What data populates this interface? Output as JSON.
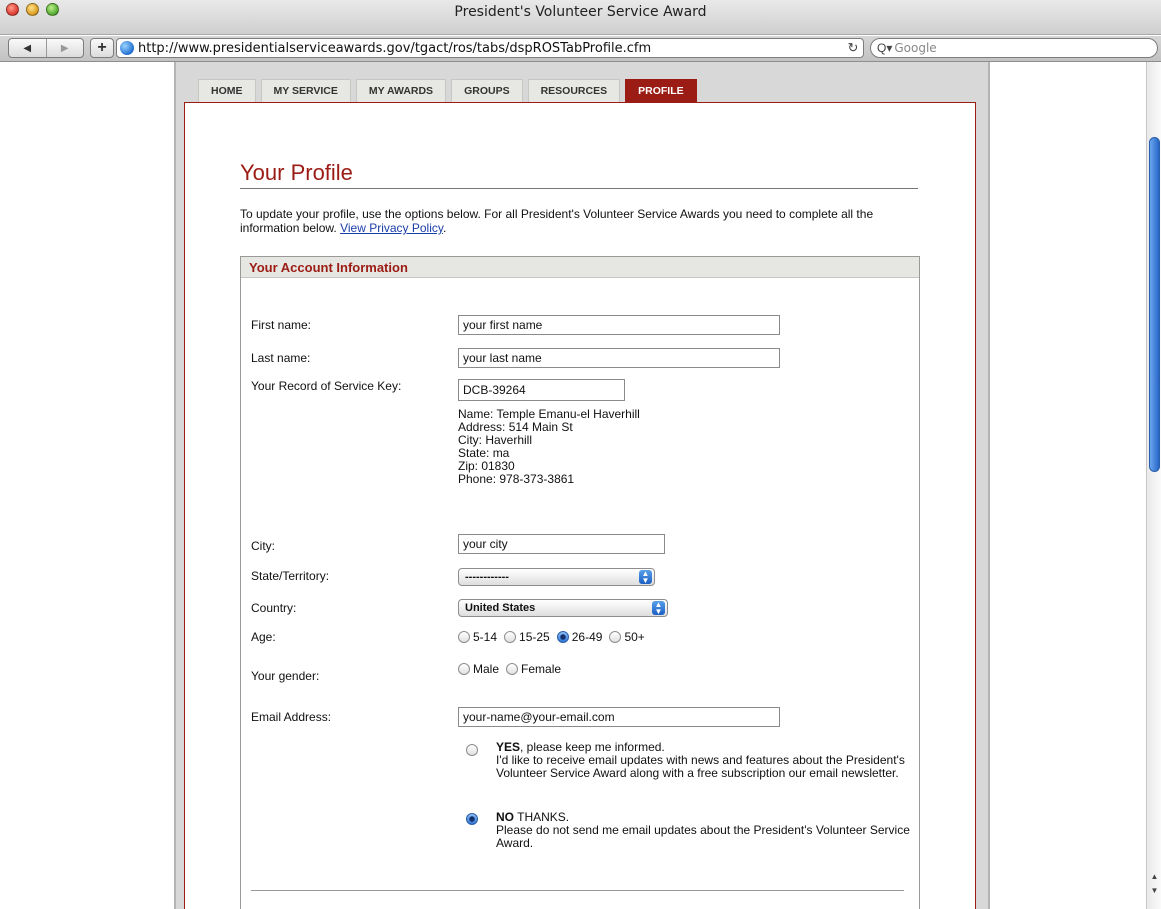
{
  "window": {
    "title": "President's Volunteer Service Award"
  },
  "browser": {
    "url": "http://www.presidentialserviceawards.gov/tgact/ros/tabs/dspROSTabProfile.cfm",
    "search_placeholder": "Google",
    "back_icon": "◀",
    "forward_icon": "▶",
    "add_icon": "+",
    "reload_icon": "↻",
    "search_icon": "Q▾"
  },
  "tabs": [
    {
      "label": "HOME",
      "active": false
    },
    {
      "label": "MY SERVICE",
      "active": false
    },
    {
      "label": "MY AWARDS",
      "active": false
    },
    {
      "label": "GROUPS",
      "active": false
    },
    {
      "label": "RESOURCES",
      "active": false
    },
    {
      "label": "PROFILE",
      "active": true
    }
  ],
  "page": {
    "title": "Your Profile",
    "intro": "To update your profile, use the options below. For all President's Volunteer Service Awards you need to complete all the information below.",
    "privacy_link": "View Privacy Policy",
    "privacy_suffix": "."
  },
  "account": {
    "header": "Your Account Information",
    "first_name": {
      "label": "First name:",
      "value": "your first name"
    },
    "last_name": {
      "label": "Last name:",
      "value": "your last name"
    },
    "record_key": {
      "label": "Your Record of Service Key:",
      "value": "DCB-39264",
      "info": [
        "Name: Temple Emanu-el Haverhill",
        "Address: 514 Main St",
        "City: Haverhill",
        "State: ma",
        "Zip: 01830",
        "Phone: 978-373-3861"
      ]
    },
    "city": {
      "label": "City:",
      "value": "your city"
    },
    "state": {
      "label": "State/Territory:",
      "value": "------------"
    },
    "country": {
      "label": "Country:",
      "value": "United States"
    },
    "age": {
      "label": "Age:",
      "options": [
        "5-14",
        "15-25",
        "26-49",
        "50+"
      ],
      "selected": "26-49"
    },
    "gender": {
      "label": "Your gender:",
      "options": [
        "Male",
        "Female"
      ],
      "selected": null
    },
    "email": {
      "label": "Email Address:",
      "value": "your-name@your-email.com"
    },
    "updates_yes": {
      "bold": "YES",
      "rest": ", please keep me informed.",
      "detail": "I'd like to receive email updates with news and features about the President's Volunteer Service Award along with a free subscription our email newsletter.",
      "selected": false
    },
    "updates_no": {
      "bold": "NO",
      "rest": " THANKS.",
      "detail": "Please do not send me email updates about the President's Volunteer Service Award.",
      "selected": true
    }
  },
  "colors": {
    "brand": "#9b1c14",
    "link": "#1a3ea8",
    "tab_bg": "#e7e7e3"
  }
}
